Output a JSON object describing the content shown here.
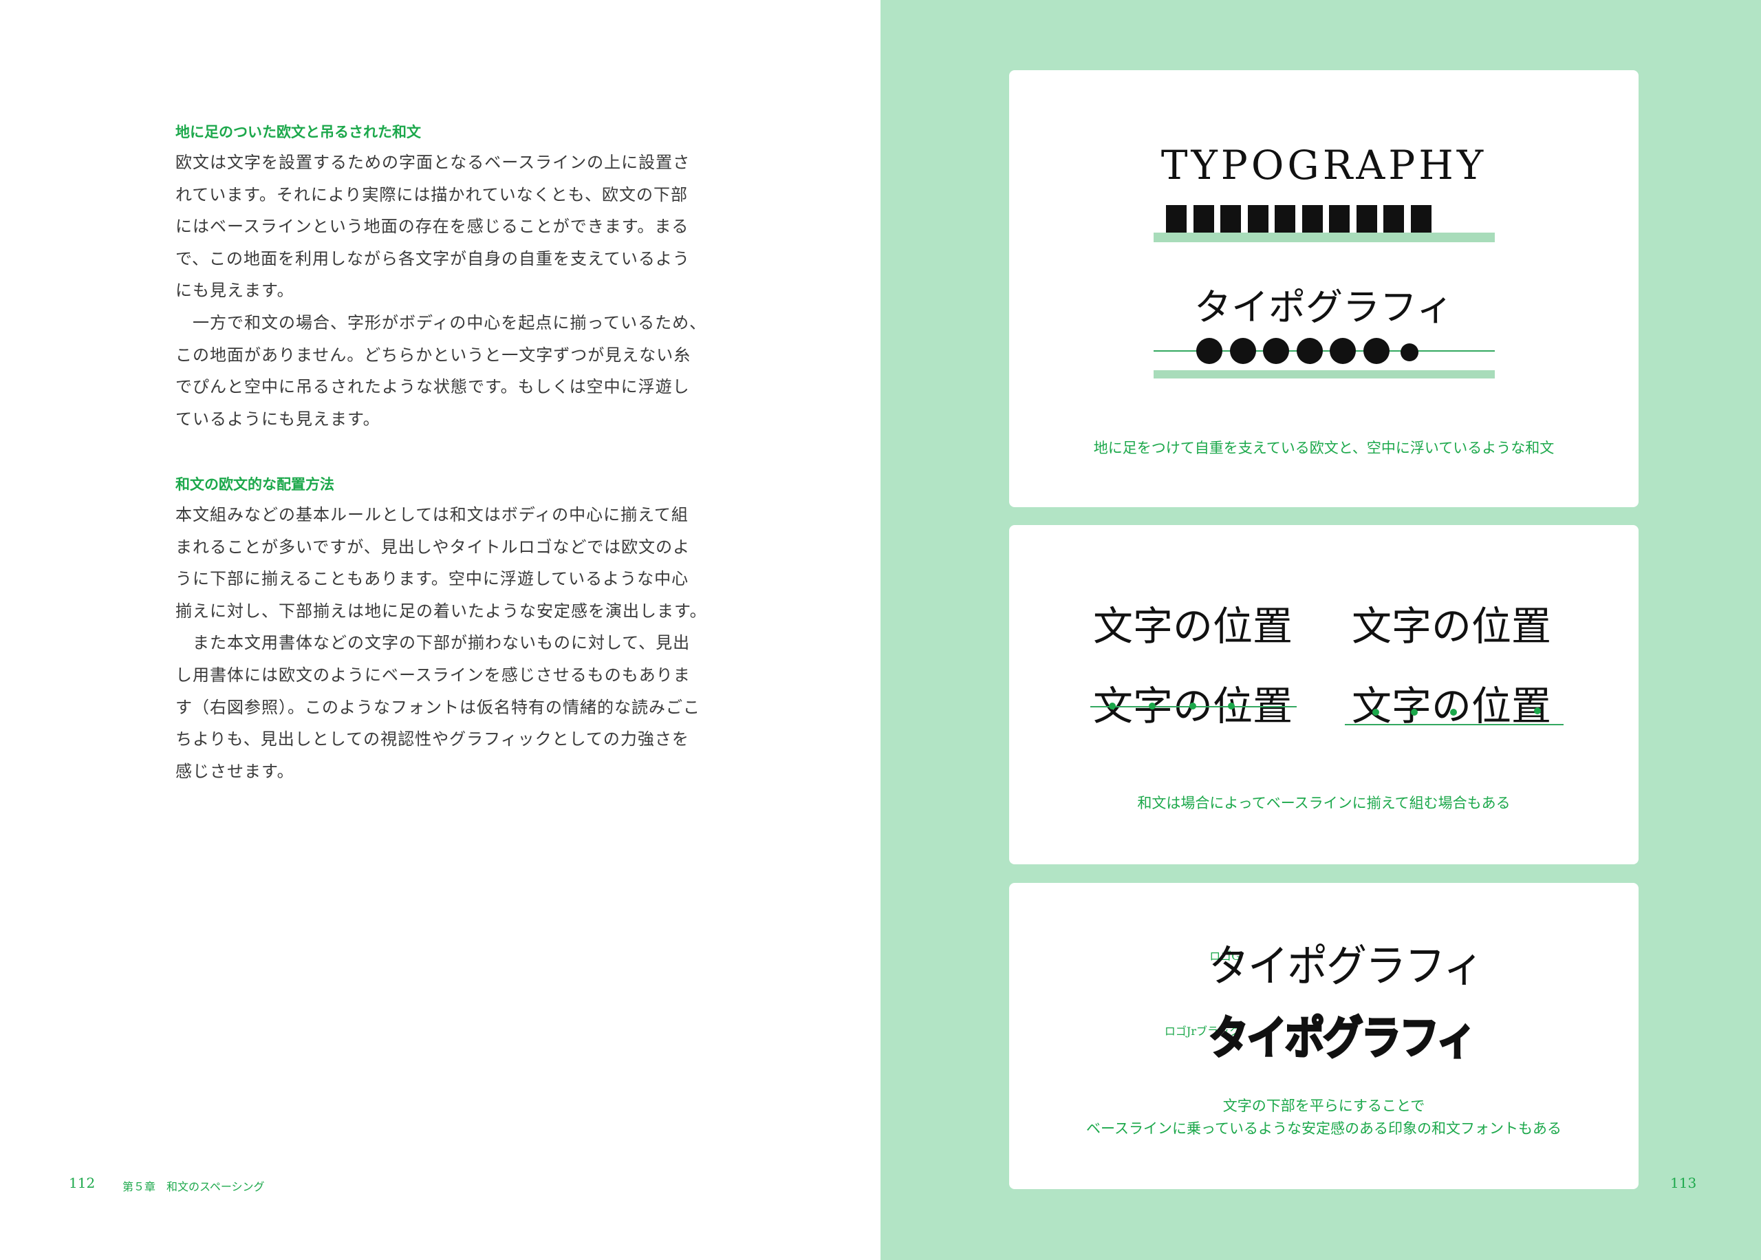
{
  "left_page": {
    "section1": {
      "heading": "地に足のついた欧文と吊るされた和文",
      "lines": [
        "欧文は文字を設置するための字面となるベースラインの上に設置さ",
        "れています。それにより実際には描かれていなくとも、欧文の下部",
        "にはベースラインという地面の存在を感じることができます。まる",
        "で、この地面を利用しながら各文字が自身の自重を支えているよう",
        "にも見えます。",
        "　一方で和文の場合、字形がボディの中心を起点に揃っているため、",
        "この地面がありません。どちらかというと一文字ずつが見えない糸",
        "でぴんと空中に吊るされたような状態です。もしくは空中に浮遊し",
        "ているようにも見えます。"
      ]
    },
    "section2": {
      "heading": "和文の欧文的な配置方法",
      "lines": [
        "本文組みなどの基本ルールとしては和文はボディの中心に揃えて組",
        "まれることが多いですが、見出しやタイトルロゴなどでは欧文のよ",
        "うに下部に揃えることもあります。空中に浮遊しているような中心",
        "揃えに対し、下部揃えは地に足の着いたような安定感を演出します。",
        "　また本文用書体などの文字の下部が揃わないものに対して、見出",
        "し用書体には欧文のようにベースラインを感じさせるものもありま",
        "す（右図参照）。このようなフォントは仮名特有の情緒的な読みごこ",
        "ちよりも、見出しとしての視認性やグラフィックとしての力強さを",
        "感じさせます。"
      ]
    },
    "folio": "112",
    "running_head": "第５章　和文のスペーシング"
  },
  "right_page": {
    "card1": {
      "latin_word": "TYPOGRAPHY",
      "kana_word": "タイポグラフィ",
      "caption": "地に足をつけて自重を支えている欧文と、空中に浮いているような和文"
    },
    "card2": {
      "word_top_left": "文字の位置",
      "word_top_right": "文字の位置",
      "word_bottom_left": "文字の位置",
      "word_bottom_right": "文字の位置",
      "caption": "和文は場合によってベースラインに揃えて組む場合もある"
    },
    "card3": {
      "font1_label": "ロゴG",
      "font1_sample": "タイポグラフィ",
      "font2_label": "ロゴJrブラック",
      "font2_sample": "タイポグラフィ",
      "caption_line1": "文字の下部を平らにすることで",
      "caption_line2": "ベースラインに乗っているような安定感のある印象の和文フォントもある"
    },
    "folio": "113"
  },
  "colors": {
    "accent_green": "#1ca84b",
    "page_bg_green": "#b2e4c5",
    "light_green_bar": "#a8dcba"
  }
}
